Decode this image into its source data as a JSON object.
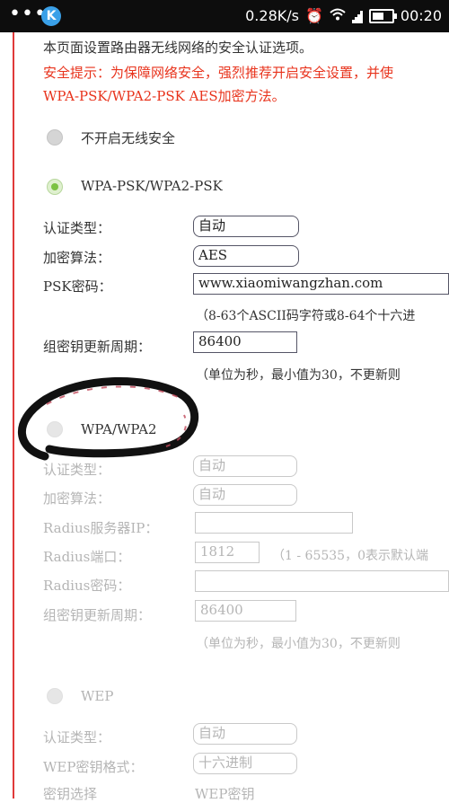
{
  "status_bar": {
    "speed": "0.28K/s",
    "time": "00:20",
    "app_icon_letter": "K"
  },
  "intro": "本页面设置路由器无线网络的安全认证选项。",
  "warning": {
    "line1": "安全提示：为保障网络安全，强烈推荐开启安全设置，并使",
    "line2": "WPA-PSK/WPA2-PSK AES加密方法。"
  },
  "options": {
    "none": "不开启无线安全",
    "wpa_psk": "WPA-PSK/WPA2-PSK",
    "wpa": "WPA/WPA2",
    "wep": "WEP"
  },
  "psk": {
    "auth_label": "认证类型：",
    "auth_value": "自动",
    "enc_label": "加密算法：",
    "enc_value": "AES",
    "key_label": "PSK密码：",
    "key_value": "www.xiaomiwangzhan.com",
    "key_hint": "（8-63个ASCII码字符或8-64个十六进",
    "period_label": "组密钥更新周期：",
    "period_value": "86400",
    "period_hint": "（单位为秒，最小值为30，不更新则"
  },
  "wpa": {
    "auth_label": "认证类型：",
    "auth_value": "自动",
    "enc_label": "加密算法：",
    "enc_value": "自动",
    "radius_ip_label": "Radius服务器IP：",
    "radius_ip_value": "",
    "radius_port_label": "Radius端口：",
    "radius_port_value": "1812",
    "radius_port_hint": "（1 - 65535，0表示默认端",
    "radius_pwd_label": "Radius密码：",
    "radius_pwd_value": "",
    "period_label": "组密钥更新周期：",
    "period_value": "86400",
    "period_hint": "（单位为秒，最小值为30，不更新则"
  },
  "wep": {
    "auth_label": "认证类型：",
    "auth_value": "自动",
    "format_label": "WEP密钥格式：",
    "format_value": "十六进制",
    "key_select_label": "密钥选择",
    "key_select_value": "WEP密钥"
  }
}
